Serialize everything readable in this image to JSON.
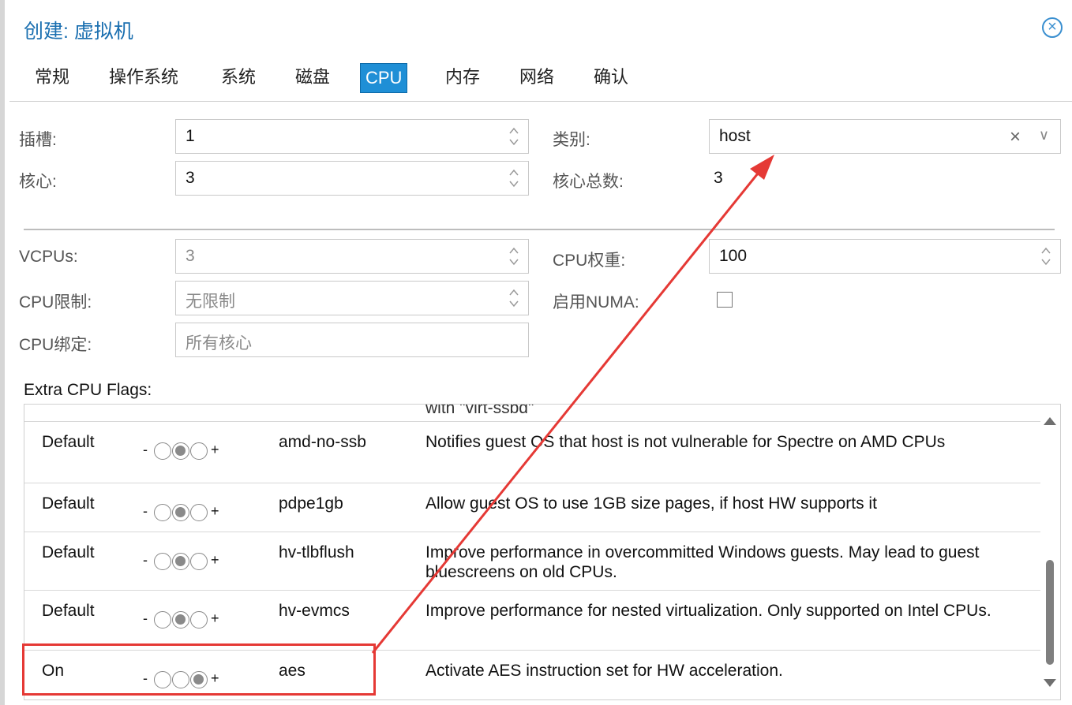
{
  "dialog": {
    "title": "创建: 虚拟机",
    "close_icon": "close-circle-icon"
  },
  "tabs": [
    "常规",
    "操作系统",
    "系统",
    "磁盘",
    "CPU",
    "内存",
    "网络",
    "确认"
  ],
  "active_tab": "CPU",
  "cpu": {
    "sockets_label": "插槽:",
    "sockets_value": "1",
    "cores_label": "核心:",
    "cores_value": "3",
    "type_label": "类别:",
    "type_value": "host",
    "type_clear": "×",
    "type_dropdown": "∨",
    "total_cores_label": "核心总数:",
    "total_cores_value": "3",
    "vcpus_label": "VCPUs:",
    "vcpus_value": "3",
    "cpu_limit_label": "CPU限制:",
    "cpu_limit_value": "无限制",
    "cpu_affinity_label": "CPU绑定:",
    "cpu_affinity_placeholder": "所有核心",
    "cpu_units_label": "CPU权重:",
    "cpu_units_value": "100",
    "numa_label": "启用NUMA:"
  },
  "flags": {
    "title": "Extra CPU Flags:",
    "partial_top_text": "with \"virt-ssbd\"",
    "minus": "-",
    "plus": "+",
    "rows": [
      {
        "state": "Default",
        "flag": "amd-no-ssb",
        "description": "Notifies guest OS that host is not vulnerable for Spectre on AMD CPUs",
        "selected": 1
      },
      {
        "state": "Default",
        "flag": "pdpe1gb",
        "description": "Allow guest OS to use 1GB size pages, if host HW supports it",
        "selected": 1
      },
      {
        "state": "Default",
        "flag": "hv-tlbflush",
        "description": "Improve performance in overcommitted Windows guests. May lead to guest bluescreens on old CPUs.",
        "selected": 1
      },
      {
        "state": "Default",
        "flag": "hv-evmcs",
        "description": "Improve performance for nested virtualization. Only supported on Intel CPUs.",
        "selected": 1
      },
      {
        "state": "On",
        "flag": "aes",
        "description": "Activate AES instruction set for HW acceleration.",
        "selected": 2
      }
    ]
  },
  "colors": {
    "accent": "#1f8fd6",
    "title": "#1a6fb0",
    "annotation": "#e53935"
  }
}
